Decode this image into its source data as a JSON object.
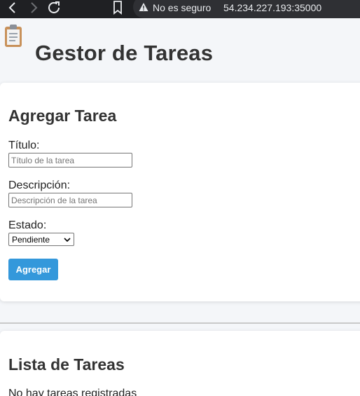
{
  "browser": {
    "security_label": "No es seguro",
    "url": "54.234.227.193:35000"
  },
  "header": {
    "title": "Gestor de Tareas",
    "icon": "clipboard-icon"
  },
  "add_task": {
    "heading": "Agregar Tarea",
    "title_label": "Título:",
    "title_placeholder": "Título de la tarea",
    "title_value": "",
    "description_label": "Descripción:",
    "description_placeholder": "Descripción de la tarea",
    "description_value": "",
    "state_label": "Estado:",
    "state_selected": "Pendiente",
    "submit_label": "Agregar",
    "accent_color": "#3498db"
  },
  "task_list": {
    "heading": "Lista de Tareas",
    "empty_message": "No hay tareas registradas"
  }
}
